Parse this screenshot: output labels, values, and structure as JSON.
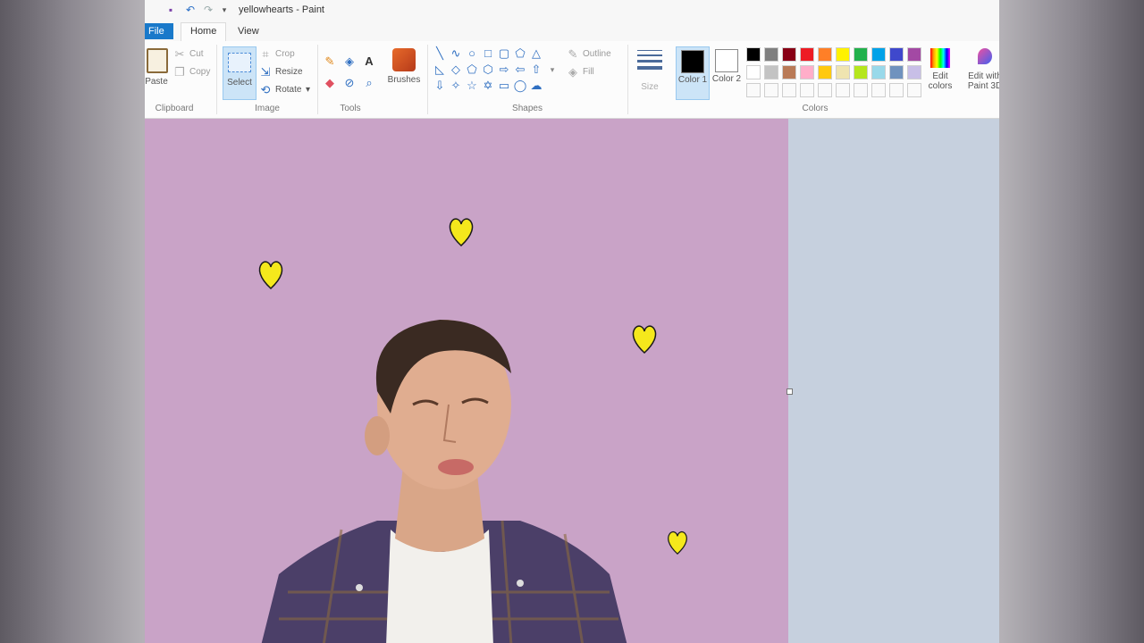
{
  "window": {
    "title": "yellowhearts - Paint"
  },
  "tabs": {
    "file": "File",
    "home": "Home",
    "view": "View"
  },
  "clipboard": {
    "paste": "Paste",
    "cut": "Cut",
    "copy": "Copy",
    "group": "Clipboard"
  },
  "image": {
    "select": "Select",
    "crop": "Crop",
    "resize": "Resize",
    "rotate": "Rotate",
    "group": "Image"
  },
  "tools": {
    "group": "Tools"
  },
  "brushes": {
    "label": "Brushes"
  },
  "shapes": {
    "outline": "Outline",
    "fill": "Fill",
    "group": "Shapes"
  },
  "size": {
    "label": "Size"
  },
  "colors": {
    "color1_label": "Color 1",
    "color2_label": "Color 2",
    "edit_colors": "Edit colors",
    "edit_paint3d": "Edit with Paint 3D",
    "group": "Colors",
    "color1": "#000000",
    "color2": "#ffffff",
    "palette_row1": [
      "#000000",
      "#7f7f7f",
      "#880015",
      "#ed1c24",
      "#ff7f27",
      "#fff200",
      "#22b14c",
      "#00a2e8",
      "#3f48cc",
      "#a349a4"
    ],
    "palette_row2": [
      "#ffffff",
      "#c3c3c3",
      "#b97a57",
      "#ffaec9",
      "#ffc90e",
      "#efe4b0",
      "#b5e61d",
      "#99d9ea",
      "#7092be",
      "#c8bfe7"
    ]
  },
  "canvas": {
    "background": "#c9a3c7",
    "heart_color": "#f5e81c"
  }
}
